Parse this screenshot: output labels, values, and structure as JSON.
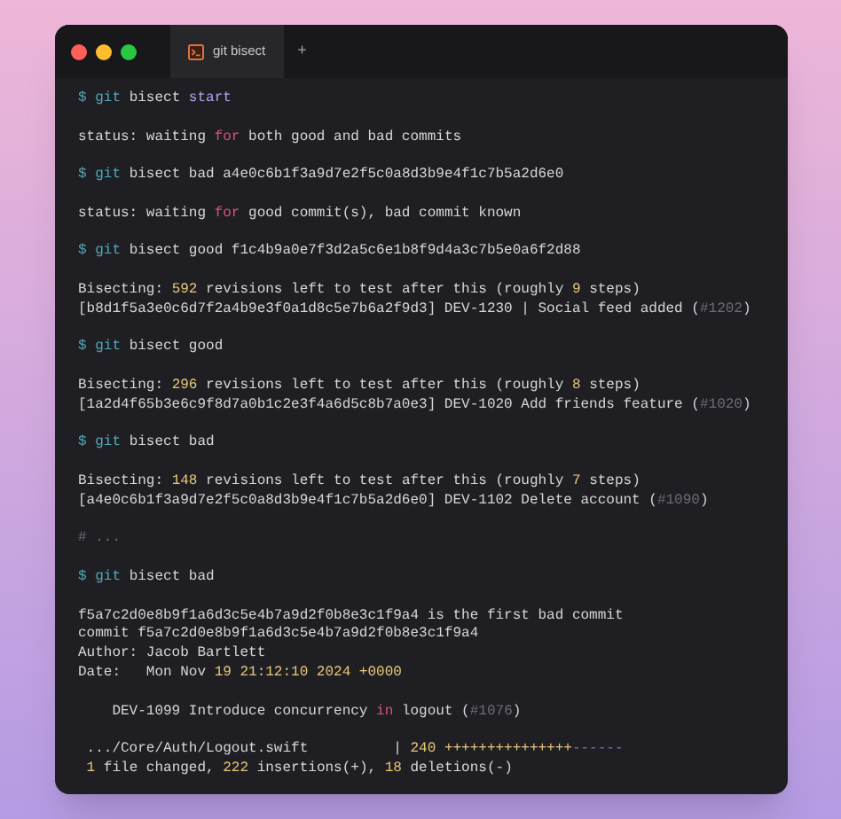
{
  "window": {
    "tabs": [
      {
        "label": "git bisect",
        "selected": true
      }
    ],
    "new_tab": "+"
  },
  "blocks": [
    [
      [
        {
          "kind": "prompt",
          "text": "$ git"
        },
        {
          "kind": "plain",
          "text": " bisect "
        },
        {
          "kind": "accent",
          "text": "start"
        }
      ]
    ],
    [
      [
        {
          "kind": "plain",
          "text": "status: waiting "
        },
        {
          "kind": "keyword",
          "text": "for"
        },
        {
          "kind": "plain",
          "text": " both good and bad commits"
        }
      ]
    ],
    [
      [
        {
          "kind": "prompt",
          "text": "$ git"
        },
        {
          "kind": "plain",
          "text": " bisect bad a4e0c6b1f3a9d7e2f5c0a8d3b9e4f1c7b5a2d6e0"
        }
      ]
    ],
    [
      [
        {
          "kind": "plain",
          "text": "status: waiting "
        },
        {
          "kind": "keyword",
          "text": "for"
        },
        {
          "kind": "plain",
          "text": " good commit(s), bad commit known"
        }
      ]
    ],
    [
      [
        {
          "kind": "prompt",
          "text": "$ git"
        },
        {
          "kind": "plain",
          "text": " bisect good f1c4b9a0e7f3d2a5c6e1b8f9d4a3c7b5e0a6f2d88"
        }
      ]
    ],
    [
      [
        {
          "kind": "plain",
          "text": "Bisecting: "
        },
        {
          "kind": "number",
          "text": "592"
        },
        {
          "kind": "plain",
          "text": " revisions left to test after this (roughly "
        },
        {
          "kind": "number",
          "text": "9"
        },
        {
          "kind": "plain",
          "text": " steps)"
        }
      ],
      [
        {
          "kind": "plain",
          "text": "[b8d1f5a3e0c6d7f2a4b9e3f0a1d8c5e7b6a2f9d3] DEV-1230 | Social feed added ("
        },
        {
          "kind": "comment",
          "text": "#1202"
        },
        {
          "kind": "plain",
          "text": ")"
        }
      ]
    ],
    [
      [
        {
          "kind": "prompt",
          "text": "$ git"
        },
        {
          "kind": "plain",
          "text": " bisect good"
        }
      ]
    ],
    [
      [
        {
          "kind": "plain",
          "text": "Bisecting: "
        },
        {
          "kind": "number",
          "text": "296"
        },
        {
          "kind": "plain",
          "text": " revisions left to test after this (roughly "
        },
        {
          "kind": "number",
          "text": "8"
        },
        {
          "kind": "plain",
          "text": " steps)"
        }
      ],
      [
        {
          "kind": "plain",
          "text": "[1a2d4f65b3e6c9f8d7a0b1c2e3f4a6d5c8b7a0e3] DEV-1020 Add friends feature ("
        },
        {
          "kind": "comment",
          "text": "#1020"
        },
        {
          "kind": "plain",
          "text": ")"
        }
      ]
    ],
    [
      [
        {
          "kind": "prompt",
          "text": "$ git"
        },
        {
          "kind": "plain",
          "text": " bisect bad"
        }
      ]
    ],
    [
      [
        {
          "kind": "plain",
          "text": "Bisecting: "
        },
        {
          "kind": "number",
          "text": "148"
        },
        {
          "kind": "plain",
          "text": " revisions left to test after this (roughly "
        },
        {
          "kind": "number",
          "text": "7"
        },
        {
          "kind": "plain",
          "text": " steps)"
        }
      ],
      [
        {
          "kind": "plain",
          "text": "[a4e0c6b1f3a9d7e2f5c0a8d3b9e4f1c7b5a2d6e0] DEV-1102 Delete account ("
        },
        {
          "kind": "comment",
          "text": "#1090"
        },
        {
          "kind": "plain",
          "text": ")"
        }
      ]
    ],
    [
      [
        {
          "kind": "comment",
          "text": "# ..."
        }
      ]
    ],
    [
      [
        {
          "kind": "prompt",
          "text": "$ git"
        },
        {
          "kind": "plain",
          "text": " bisect bad"
        }
      ]
    ],
    [
      [
        {
          "kind": "plain",
          "text": "f5a7c2d0e8b9f1a6d3c5e4b7a9d2f0b8e3c1f9a4 is the first bad commit"
        }
      ],
      [
        {
          "kind": "plain",
          "text": "commit f5a7c2d0e8b9f1a6d3c5e4b7a9d2f0b8e3c1f9a4"
        }
      ],
      [
        {
          "kind": "plain",
          "text": "Author: Jacob Bartlett"
        }
      ],
      [
        {
          "kind": "plain",
          "text": "Date:   Mon Nov "
        },
        {
          "kind": "number",
          "text": "19 21:12:10 2024 +0000"
        }
      ]
    ],
    [
      [
        {
          "kind": "plain",
          "text": "    DEV-1099 Introduce concurrency "
        },
        {
          "kind": "keyword",
          "text": "in"
        },
        {
          "kind": "plain",
          "text": " logout ("
        },
        {
          "kind": "comment",
          "text": "#1076"
        },
        {
          "kind": "plain",
          "text": ")"
        }
      ]
    ],
    [
      [
        {
          "kind": "plain",
          "text": " .../Core/Auth/Logout.swift          | "
        },
        {
          "kind": "number",
          "text": "240 +++++++++++++++"
        },
        {
          "kind": "removed",
          "text": "------"
        }
      ],
      [
        {
          "kind": "number",
          "text": " 1"
        },
        {
          "kind": "plain",
          "text": " file changed, "
        },
        {
          "kind": "number",
          "text": "222"
        },
        {
          "kind": "plain",
          "text": " insertions(+), "
        },
        {
          "kind": "number",
          "text": "18"
        },
        {
          "kind": "plain",
          "text": " deletions(-)"
        }
      ]
    ]
  ]
}
